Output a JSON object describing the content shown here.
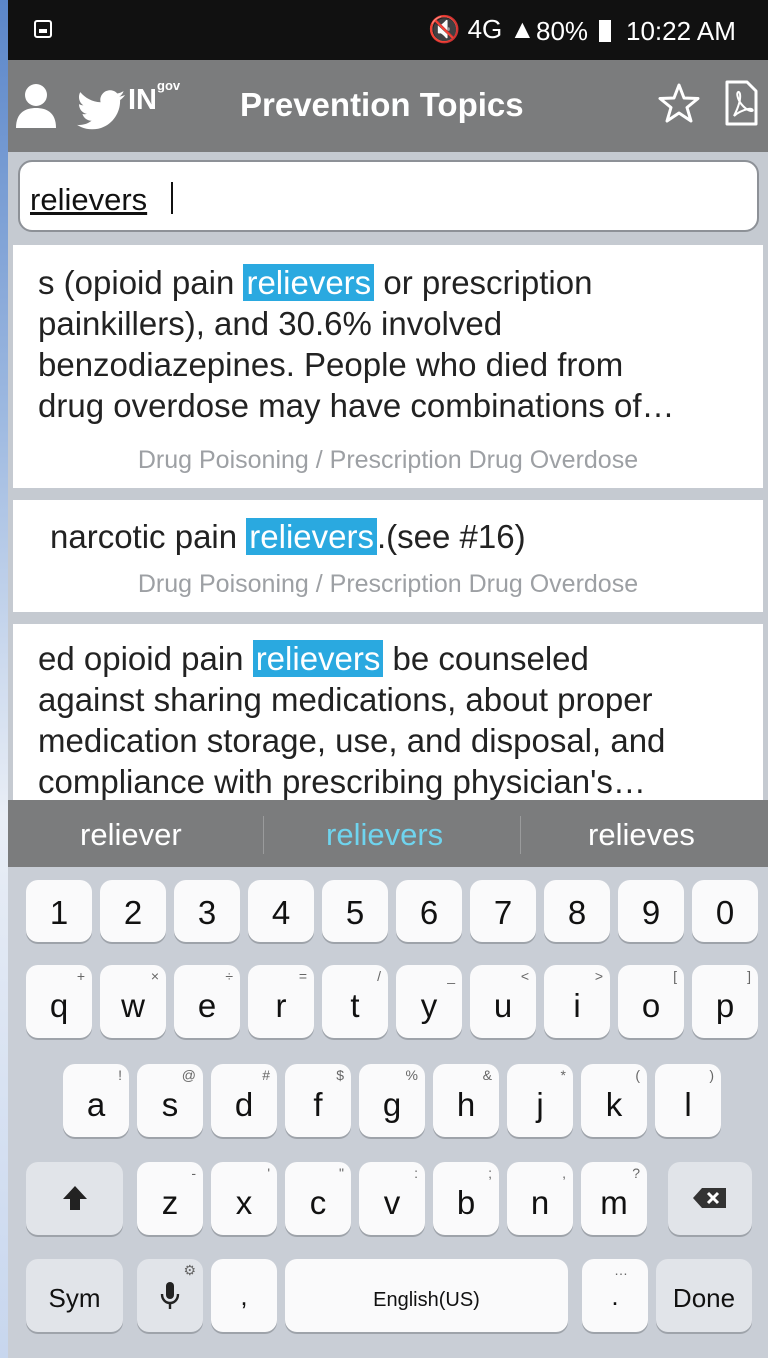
{
  "status_bar": {
    "icons": "🔇 4G ▲",
    "battery": "80%",
    "time": "10:22 AM"
  },
  "app_bar": {
    "brand": "IN",
    "brand_suffix": "gov",
    "title": "Prevention Topics"
  },
  "search": {
    "value": "relievers"
  },
  "results": [
    {
      "pre": "s (opioid pain ",
      "highlight": "relievers",
      "line1_post": " or prescription",
      "lines": [
        "painkillers), and 30.6% involved",
        "benzodiazepines. People who died from",
        "drug overdose may have combinations of…"
      ],
      "source": "Drug Poisoning / Prescription Drug Overdose"
    },
    {
      "pre": "narcotic pain ",
      "highlight": "relievers",
      "line1_post": ".(see #16)",
      "lines": [],
      "source": "Drug Poisoning / Prescription Drug Overdose"
    },
    {
      "pre": "ed opioid pain ",
      "highlight": "relievers",
      "line1_post": " be counseled",
      "lines": [
        "against sharing medications, about proper",
        "medication storage, use, and disposal, and",
        "compliance with prescribing physician's…"
      ],
      "source": ""
    }
  ],
  "suggestions": [
    "reliever",
    "relievers",
    "relieves"
  ],
  "keyboard": {
    "numbers": [
      "1",
      "2",
      "3",
      "4",
      "5",
      "6",
      "7",
      "8",
      "9",
      "0"
    ],
    "row1": [
      {
        "k": "q",
        "s": "+"
      },
      {
        "k": "w",
        "s": "×"
      },
      {
        "k": "e",
        "s": "÷"
      },
      {
        "k": "r",
        "s": "="
      },
      {
        "k": "t",
        "s": "/"
      },
      {
        "k": "y",
        "s": "_"
      },
      {
        "k": "u",
        "s": "<"
      },
      {
        "k": "i",
        "s": ">"
      },
      {
        "k": "o",
        "s": "["
      },
      {
        "k": "p",
        "s": "]"
      }
    ],
    "row2": [
      {
        "k": "a",
        "s": "!"
      },
      {
        "k": "s",
        "s": "@"
      },
      {
        "k": "d",
        "s": "#"
      },
      {
        "k": "f",
        "s": "$"
      },
      {
        "k": "g",
        "s": "%"
      },
      {
        "k": "h",
        "s": "&"
      },
      {
        "k": "j",
        "s": "*"
      },
      {
        "k": "k",
        "s": "("
      },
      {
        "k": "l",
        "s": ")"
      }
    ],
    "row3": [
      {
        "k": "z",
        "s": "-"
      },
      {
        "k": "x",
        "s": "'"
      },
      {
        "k": "c",
        "s": "\""
      },
      {
        "k": "v",
        "s": ":"
      },
      {
        "k": "b",
        "s": ";"
      },
      {
        "k": "n",
        "s": ","
      },
      {
        "k": "m",
        "s": "?"
      }
    ],
    "sym_label": "Sym",
    "comma": ",",
    "space_label": "English(US)",
    "period": ".",
    "period_sub": "…",
    "done_label": "Done"
  },
  "colors": {
    "app_bar": "#7b7c7d",
    "highlight": "#2aa9e0",
    "suggestion_selected": "#6fd4ee"
  }
}
